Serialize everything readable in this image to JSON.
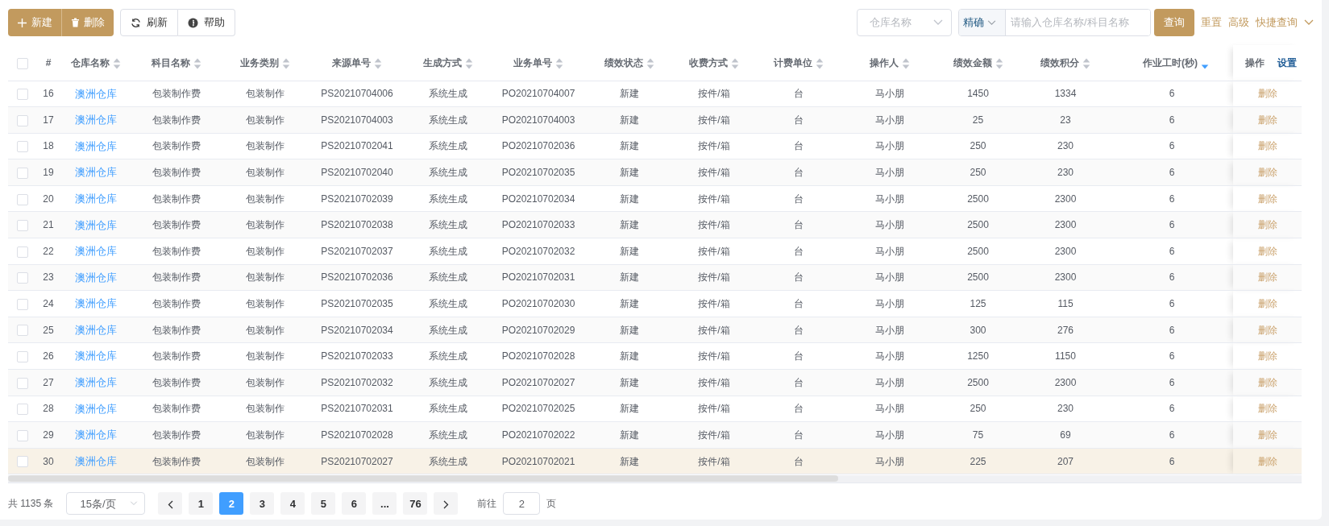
{
  "toolbar": {
    "primary_buttons": [
      {
        "label": "新建"
      },
      {
        "label": "删除"
      }
    ],
    "secondary_buttons": [
      {
        "label": "刷新"
      },
      {
        "label": "帮助"
      }
    ]
  },
  "filter": {
    "warehouse_select": {
      "placeholder": "仓库名称"
    },
    "match_mode": "精确",
    "search": {
      "placeholder": "请输入仓库名称/科目名称"
    },
    "query_button": "查询",
    "links": [
      "重置",
      "高级",
      "快捷查询"
    ]
  },
  "table": {
    "select_all": {
      "checked": false
    },
    "columns": [
      {
        "label": "#",
        "sortable": false
      },
      {
        "label": "仓库名称",
        "sortable": true,
        "sorted_descending": false
      },
      {
        "label": "科目名称",
        "sortable": true,
        "sorted_descending": false
      },
      {
        "label": "业务类别",
        "sortable": true,
        "sorted_descending": false
      },
      {
        "label": "来源单号",
        "sortable": true,
        "sorted_descending": false
      },
      {
        "label": "生成方式",
        "sortable": true,
        "sorted_descending": false
      },
      {
        "label": "业务单号",
        "sortable": true,
        "sorted_descending": false
      },
      {
        "label": "绩效状态",
        "sortable": true,
        "sorted_descending": false
      },
      {
        "label": "收费方式",
        "sortable": true,
        "sorted_descending": false
      },
      {
        "label": "计费单位",
        "sortable": true,
        "sorted_descending": false
      },
      {
        "label": "操作人",
        "sortable": true,
        "sorted_descending": false
      },
      {
        "label": "绩效金额",
        "sortable": true,
        "sorted_descending": false
      },
      {
        "label": "绩效积分",
        "sortable": true,
        "sorted_descending": false
      },
      {
        "label": "作业工时(秒)",
        "sortable": true,
        "sorted_descending": true
      }
    ],
    "actions_header": "操作",
    "settings_link": "设置",
    "rows": [
      {
        "checked": false,
        "highlighted": false,
        "cells": [
          "16",
          "澳洲仓库",
          "包装制作费",
          "包装制作",
          "PS20210704006",
          "系统生成",
          "PO20210704007",
          "新建",
          "按件/箱",
          "台",
          "马小朋",
          "1450",
          "1334",
          "6"
        ],
        "action": "删除"
      },
      {
        "checked": false,
        "highlighted": false,
        "cells": [
          "17",
          "澳洲仓库",
          "包装制作费",
          "包装制作",
          "PS20210704003",
          "系统生成",
          "PO20210704003",
          "新建",
          "按件/箱",
          "台",
          "马小朋",
          "25",
          "23",
          "6"
        ],
        "action": "删除"
      },
      {
        "checked": false,
        "highlighted": false,
        "cells": [
          "18",
          "澳洲仓库",
          "包装制作费",
          "包装制作",
          "PS20210702041",
          "系统生成",
          "PO20210702036",
          "新建",
          "按件/箱",
          "台",
          "马小朋",
          "250",
          "230",
          "6"
        ],
        "action": "删除"
      },
      {
        "checked": false,
        "highlighted": false,
        "cells": [
          "19",
          "澳洲仓库",
          "包装制作费",
          "包装制作",
          "PS20210702040",
          "系统生成",
          "PO20210702035",
          "新建",
          "按件/箱",
          "台",
          "马小朋",
          "250",
          "230",
          "6"
        ],
        "action": "删除"
      },
      {
        "checked": false,
        "highlighted": false,
        "cells": [
          "20",
          "澳洲仓库",
          "包装制作费",
          "包装制作",
          "PS20210702039",
          "系统生成",
          "PO20210702034",
          "新建",
          "按件/箱",
          "台",
          "马小朋",
          "2500",
          "2300",
          "6"
        ],
        "action": "删除"
      },
      {
        "checked": false,
        "highlighted": false,
        "cells": [
          "21",
          "澳洲仓库",
          "包装制作费",
          "包装制作",
          "PS20210702038",
          "系统生成",
          "PO20210702033",
          "新建",
          "按件/箱",
          "台",
          "马小朋",
          "2500",
          "2300",
          "6"
        ],
        "action": "删除"
      },
      {
        "checked": false,
        "highlighted": false,
        "cells": [
          "22",
          "澳洲仓库",
          "包装制作费",
          "包装制作",
          "PS20210702037",
          "系统生成",
          "PO20210702032",
          "新建",
          "按件/箱",
          "台",
          "马小朋",
          "2500",
          "2300",
          "6"
        ],
        "action": "删除"
      },
      {
        "checked": false,
        "highlighted": false,
        "cells": [
          "23",
          "澳洲仓库",
          "包装制作费",
          "包装制作",
          "PS20210702036",
          "系统生成",
          "PO20210702031",
          "新建",
          "按件/箱",
          "台",
          "马小朋",
          "2500",
          "2300",
          "6"
        ],
        "action": "删除"
      },
      {
        "checked": false,
        "highlighted": false,
        "cells": [
          "24",
          "澳洲仓库",
          "包装制作费",
          "包装制作",
          "PS20210702035",
          "系统生成",
          "PO20210702030",
          "新建",
          "按件/箱",
          "台",
          "马小朋",
          "125",
          "115",
          "6"
        ],
        "action": "删除"
      },
      {
        "checked": false,
        "highlighted": false,
        "cells": [
          "25",
          "澳洲仓库",
          "包装制作费",
          "包装制作",
          "PS20210702034",
          "系统生成",
          "PO20210702029",
          "新建",
          "按件/箱",
          "台",
          "马小朋",
          "300",
          "276",
          "6"
        ],
        "action": "删除"
      },
      {
        "checked": false,
        "highlighted": false,
        "cells": [
          "26",
          "澳洲仓库",
          "包装制作费",
          "包装制作",
          "PS20210702033",
          "系统生成",
          "PO20210702028",
          "新建",
          "按件/箱",
          "台",
          "马小朋",
          "1250",
          "1150",
          "6"
        ],
        "action": "删除"
      },
      {
        "checked": false,
        "highlighted": false,
        "cells": [
          "27",
          "澳洲仓库",
          "包装制作费",
          "包装制作",
          "PS20210702032",
          "系统生成",
          "PO20210702027",
          "新建",
          "按件/箱",
          "台",
          "马小朋",
          "2500",
          "2300",
          "6"
        ],
        "action": "删除"
      },
      {
        "checked": false,
        "highlighted": false,
        "cells": [
          "28",
          "澳洲仓库",
          "包装制作费",
          "包装制作",
          "PS20210702031",
          "系统生成",
          "PO20210702025",
          "新建",
          "按件/箱",
          "台",
          "马小朋",
          "250",
          "230",
          "6"
        ],
        "action": "删除"
      },
      {
        "checked": false,
        "highlighted": false,
        "cells": [
          "29",
          "澳洲仓库",
          "包装制作费",
          "包装制作",
          "PS20210702028",
          "系统生成",
          "PO20210702022",
          "新建",
          "按件/箱",
          "台",
          "马小朋",
          "75",
          "69",
          "6"
        ],
        "action": "删除"
      },
      {
        "checked": false,
        "highlighted": true,
        "cells": [
          "30",
          "澳洲仓库",
          "包装制作费",
          "包装制作",
          "PS20210702027",
          "系统生成",
          "PO20210702021",
          "新建",
          "按件/箱",
          "台",
          "马小朋",
          "225",
          "207",
          "6"
        ],
        "action": "删除"
      }
    ]
  },
  "pagination": {
    "total": "共 1135 条",
    "page_size": "15条/页",
    "pages": [
      {
        "label": "1",
        "selected": false
      },
      {
        "label": "2",
        "selected": true
      },
      {
        "label": "3",
        "selected": false
      },
      {
        "label": "4",
        "selected": false
      },
      {
        "label": "5",
        "selected": false
      },
      {
        "label": "6",
        "selected": false
      },
      {
        "label": "...",
        "selected": false
      },
      {
        "label": "76",
        "selected": false
      }
    ],
    "goto_label": "前往",
    "goto_value": "2",
    "goto_suffix": "页"
  }
}
